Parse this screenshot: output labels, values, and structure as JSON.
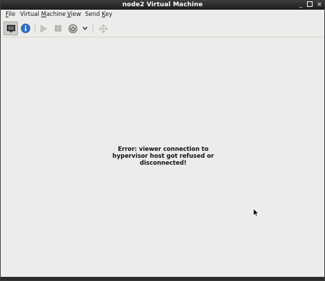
{
  "window": {
    "title": "node2 Virtual Machine",
    "controls": {
      "minimize": "_",
      "close": "×"
    }
  },
  "menubar": {
    "items": [
      {
        "mnemonic": "F",
        "rest": "ile"
      },
      {
        "before": "Virtual ",
        "mnemonic": "M",
        "rest": "achine"
      },
      {
        "mnemonic": "V",
        "rest": "iew"
      },
      {
        "before": "Send ",
        "mnemonic": "K",
        "rest": "ey"
      }
    ]
  },
  "toolbar": {
    "buttons": [
      {
        "icon": "console-monitor-icon",
        "state": "active"
      },
      {
        "icon": "details-info-icon"
      },
      {
        "icon": "run-play-icon",
        "enabled": false
      },
      {
        "icon": "pause-icon",
        "enabled": false
      },
      {
        "icon": "power-icon"
      },
      {
        "icon": "chevron-down-icon"
      },
      {
        "icon": "fullscreen-move-icon",
        "enabled": false
      }
    ]
  },
  "content": {
    "error_message": "Error: viewer connection to\nhypervisor host got refused or\ndisconnected!"
  },
  "colors": {
    "titlebar": "#262626",
    "background": "#edecea",
    "info_blue": "#2c6fc9"
  }
}
